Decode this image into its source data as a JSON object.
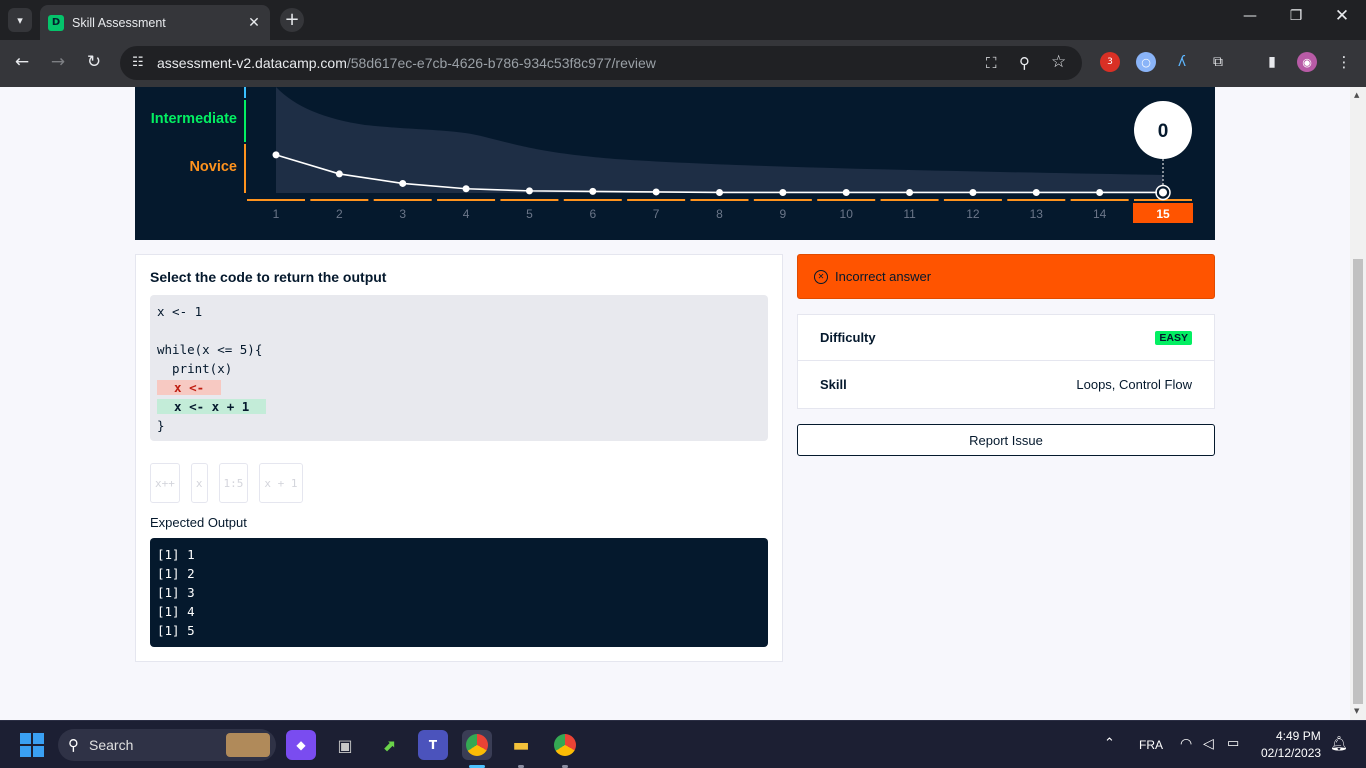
{
  "browser": {
    "tab_title": "Skill Assessment",
    "url_domain": "assessment-v2.datacamp.com",
    "url_path": "/58d617ec-e7cb-4626-b786-934c53f8c977/review",
    "extension_badge": "3"
  },
  "chart": {
    "level_labels": [
      "Intermediate",
      "Novice"
    ],
    "score": "0",
    "x_labels": [
      "1",
      "2",
      "3",
      "4",
      "5",
      "6",
      "7",
      "8",
      "9",
      "10",
      "11",
      "12",
      "13",
      "14",
      "15"
    ],
    "active_question": "15",
    "colors": {
      "intermediate": "#03ef62",
      "novice": "#ff931e",
      "active": "#ff5400",
      "background": "#05192d"
    }
  },
  "chart_data": {
    "type": "line",
    "x": [
      1,
      2,
      3,
      4,
      5,
      6,
      7,
      8,
      9,
      10,
      11,
      12,
      13,
      14,
      15
    ],
    "series": [
      {
        "values": [
          36,
          18,
          9,
          4,
          2,
          1.5,
          1,
          0.5,
          0.5,
          0.5,
          0.5,
          0.5,
          0.5,
          0.5,
          0.5
        ]
      }
    ],
    "ylim": [
      0,
      100
    ],
    "grid": false,
    "legend": "none"
  },
  "question": {
    "prompt": "Select the code to return the output",
    "code_lines": [
      {
        "text": "x <- 1",
        "type": "plain"
      },
      {
        "text": "",
        "type": "plain"
      },
      {
        "text": "while(x <= 5){",
        "type": "plain"
      },
      {
        "text": "  print(x)",
        "type": "plain"
      },
      {
        "text": "x <-",
        "type": "wrong"
      },
      {
        "text": "x <- x + 1",
        "type": "right"
      },
      {
        "text": "}",
        "type": "plain"
      }
    ],
    "options": [
      "x++",
      "x",
      "1:5",
      "x + 1"
    ],
    "expected_label": "Expected Output",
    "output_lines": [
      "[1] 1",
      "[1] 2",
      "[1] 3",
      "[1] 4",
      "[1] 5"
    ]
  },
  "result": {
    "banner_text": "Incorrect answer",
    "difficulty_label": "Difficulty",
    "difficulty_value": "EASY",
    "skill_label": "Skill",
    "skill_value": "Loops, Control Flow",
    "report_label": "Report Issue"
  },
  "taskbar": {
    "search_placeholder": "Search",
    "language": "FRA",
    "time": "4:49 PM",
    "date": "02/12/2023"
  }
}
